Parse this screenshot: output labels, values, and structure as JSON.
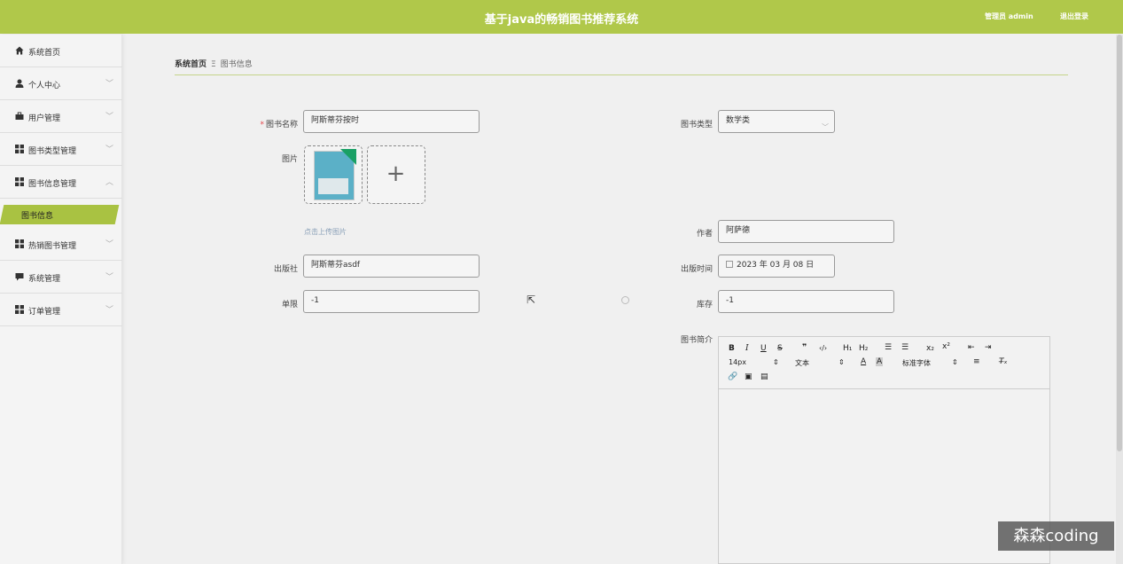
{
  "header": {
    "title": "基于java的畅销图书推荐系统",
    "user": "管理员 admin",
    "logout": "退出登录"
  },
  "sidebar": {
    "items": [
      {
        "label": "系统首页",
        "icon": "home-icon"
      },
      {
        "label": "个人中心",
        "icon": "user-icon"
      },
      {
        "label": "用户管理",
        "icon": "briefcase-icon"
      },
      {
        "label": "图书类型管理",
        "icon": "grid-icon"
      },
      {
        "label": "图书信息管理",
        "icon": "grid-icon"
      },
      {
        "label": "热销图书管理",
        "icon": "grid-icon"
      },
      {
        "label": "系统管理",
        "icon": "chat-icon"
      },
      {
        "label": "订单管理",
        "icon": "grid-icon"
      }
    ],
    "active_sub": "图书信息"
  },
  "breadcrumb": {
    "home": "系统首页",
    "separator": "Ξ",
    "current": "图书信息"
  },
  "form": {
    "name_label": "图书名称",
    "name_value": "阿斯蒂芬按时",
    "type_label": "图书类型",
    "type_value": "数学类",
    "image_label": "图片",
    "upload_hint": "点击上传图片",
    "author_label": "作者",
    "author_value": "阿萨德",
    "publisher_label": "出版社",
    "publisher_value": "阿斯蒂芬asdf",
    "pubdate_label": "出版时间",
    "pubdate_value": "2023 年 03 月 08 日",
    "limit_label": "单限",
    "limit_value": "-1",
    "stock_label": "库存",
    "stock_value": "-1",
    "intro_label": "图书简介"
  },
  "editor": {
    "font_size": "14px",
    "paragraph": "文本",
    "font_family": "标准字体"
  },
  "watermark": "森森coding",
  "colors": {
    "accent": "#b0c84a",
    "required": "#e5484d"
  }
}
